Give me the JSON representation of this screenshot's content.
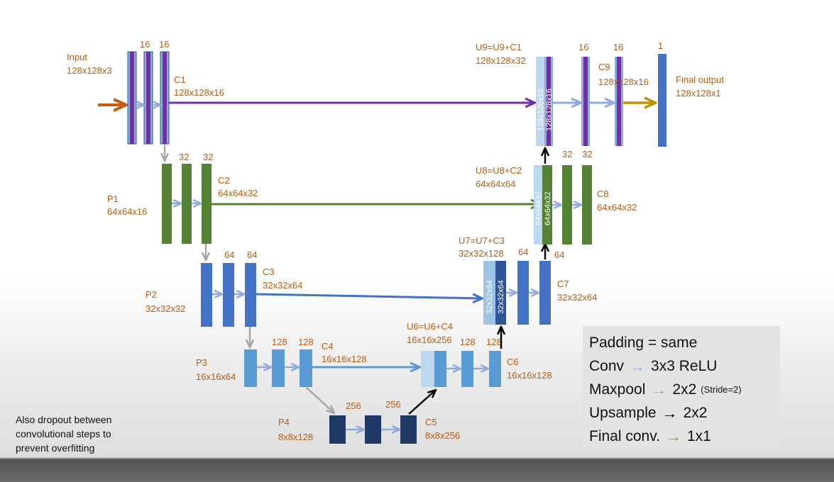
{
  "note": [
    "Also dropout between",
    "convolutional steps to",
    "prevent overfitting"
  ],
  "legend": {
    "padding": "Padding = same",
    "conv_term": "Conv",
    "conv_value": "3x3 ReLU",
    "maxpool_term": "Maxpool",
    "maxpool_value": "2x2",
    "maxpool_note": "(Stride=2)",
    "upsample_term": "Upsample",
    "upsample_value": "2x2",
    "final_term": "Final conv.",
    "final_value": "1x1",
    "arrow_glyph": "→"
  },
  "colors": {
    "label": "#b85c10",
    "purple": "#7030a0",
    "green": "#548235",
    "blue1": "#4472c4",
    "blue2": "#5b9bd5",
    "navy": "#203864",
    "conv_arrow": "#8faadc",
    "pool_arrow": "#a6a6a6",
    "up_arrow": "#000000",
    "input_arrow": "#c55a11",
    "final_arrow": "#bf9000",
    "final_block": "#4472c4"
  },
  "diagram": {
    "input": {
      "name": "Input",
      "shape": "128x128x3"
    },
    "final": {
      "name": "Final output",
      "shape": "128x128x1"
    },
    "filters": {
      "c1a": "16",
      "c1b": "16",
      "c2a": "32",
      "c2b": "32",
      "c3a": "64",
      "c3b": "64",
      "c4a": "128",
      "c4b": "128",
      "c5a": "256",
      "c5b": "256",
      "c6a": "128",
      "c6b": "128",
      "c7a": "64",
      "c7b": "64",
      "c8a": "32",
      "c8b": "32",
      "c9a": "16",
      "c9b": "16",
      "out": "1"
    },
    "labels": {
      "c1": {
        "name": "C1",
        "shape": "128x128x16"
      },
      "c2": {
        "name": "C2",
        "shape": "64x64x32"
      },
      "c3": {
        "name": "C3",
        "shape": "32x32x64"
      },
      "c4": {
        "name": "C4",
        "shape": "16x16x128"
      },
      "c5": {
        "name": "C5",
        "shape": "8x8x256"
      },
      "p1": {
        "name": "P1",
        "shape": "64x64x16"
      },
      "p2": {
        "name": "P2",
        "shape": "32x32x32"
      },
      "p3": {
        "name": "P3",
        "shape": "16x16x64"
      },
      "p4": {
        "name": "P4",
        "shape": "8x8x128"
      },
      "u6": {
        "name": "U6=U6+C4",
        "shape": "16x16x256"
      },
      "u7": {
        "name": "U7=U7+C3",
        "shape": "32x32x128"
      },
      "u8": {
        "name": "U8=U8+C2",
        "shape": "64x64x64"
      },
      "u9": {
        "name": "U9=U9+C1",
        "shape": "128x128x32"
      },
      "c6": {
        "name": "C6",
        "shape": "16x16x128"
      },
      "c7": {
        "name": "C7",
        "shape": "32x32x64"
      },
      "c8": {
        "name": "C8",
        "shape": "64x64x32"
      },
      "c9": {
        "name": "C9",
        "shape": "128x128x16"
      }
    },
    "concat_text": {
      "u9_left": "128x128x16",
      "u9_right": "128x128x16",
      "u8_left": "64x64x32",
      "u8_right": "64x64x32",
      "u7_left": "32x32x64",
      "u7_right": "32x32x64"
    }
  }
}
